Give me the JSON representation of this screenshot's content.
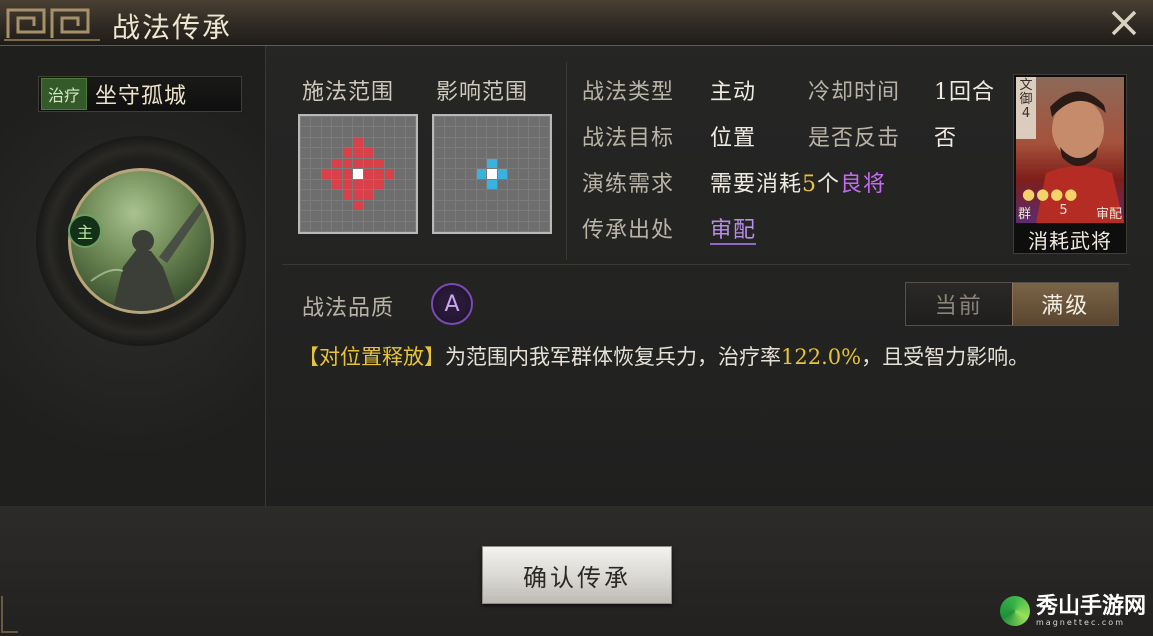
{
  "title": "战法传承",
  "skill": {
    "tag": "治疗",
    "name": "坐守孤城",
    "main_badge": "主"
  },
  "ranges": {
    "cast_label": "施法范围",
    "effect_label": "影响范围"
  },
  "info": {
    "type_label": "战法类型",
    "type_value": "主动",
    "cooldown_label": "冷却时间",
    "cooldown_value": "1回合",
    "target_label": "战法目标",
    "target_value": "位置",
    "counter_label": "是否反击",
    "counter_value": "否",
    "drill_label": "演练需求",
    "drill_prefix": "需要消耗",
    "drill_count": "5",
    "drill_unit": "个",
    "drill_item": "良将",
    "source_label": "传承出处",
    "source_value": "审配"
  },
  "card": {
    "side_text": "文御4",
    "stars": "●●●●",
    "faction": "群",
    "cost": "5",
    "name": "审配",
    "caption": "消耗武将"
  },
  "quality": {
    "label": "战法品质",
    "grade": "A"
  },
  "toggle": {
    "current": "当前",
    "max": "满级"
  },
  "description": {
    "tag": "【对位置释放】",
    "text_before": "为范围内我军群体恢复兵力，治疗率",
    "rate": "122.0%",
    "text_after": "，且受智力影响。"
  },
  "confirm_button": "确认传承",
  "watermark": {
    "name": "秀山手游网",
    "url": "magnettec.com"
  },
  "colors": {
    "accent_gold": "#e7c33a",
    "accent_purple": "#c46bf0",
    "cast_range": "#d9414a",
    "effect_range": "#3ab2e0"
  }
}
